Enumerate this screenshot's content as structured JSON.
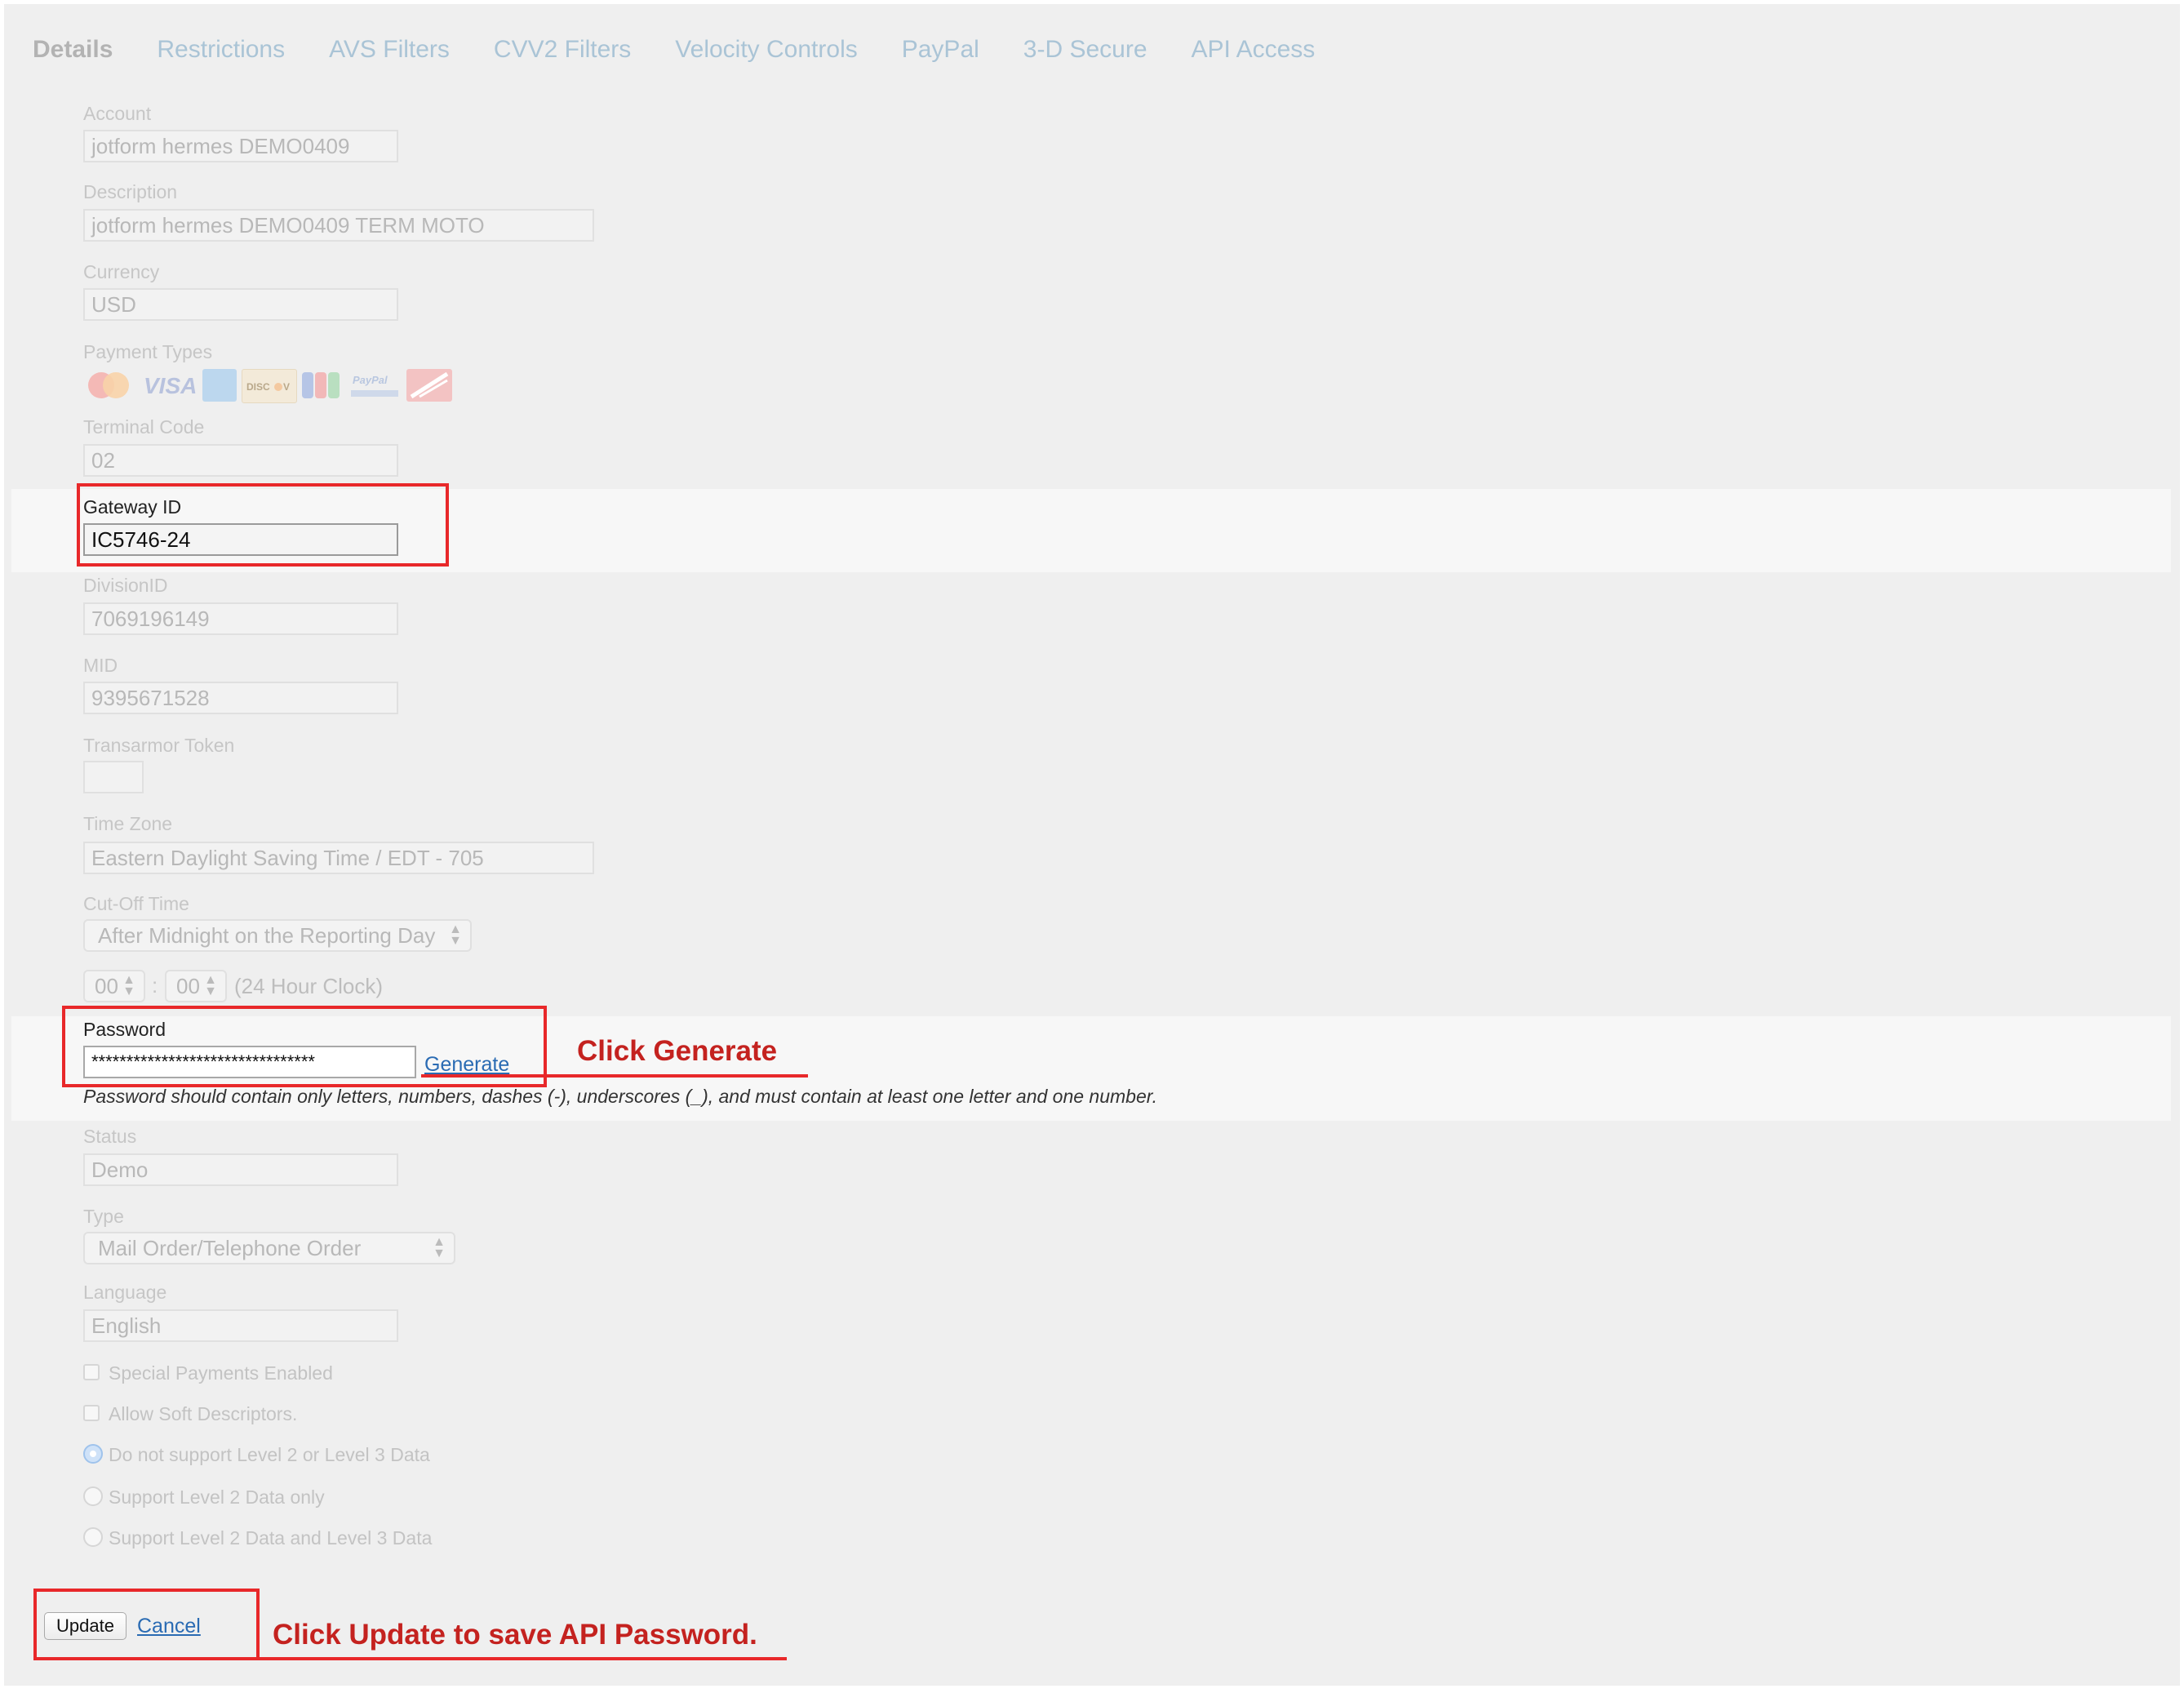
{
  "tabs": [
    {
      "label": "Details",
      "active": true
    },
    {
      "label": "Restrictions"
    },
    {
      "label": "AVS Filters"
    },
    {
      "label": "CVV2 Filters"
    },
    {
      "label": "Velocity Controls"
    },
    {
      "label": "PayPal"
    },
    {
      "label": "3-D Secure"
    },
    {
      "label": "API Access"
    }
  ],
  "fields": {
    "account": {
      "label": "Account",
      "value": "jotform hermes DEMO0409"
    },
    "description": {
      "label": "Description",
      "value": "jotform hermes DEMO0409 TERM MOTO"
    },
    "currency": {
      "label": "Currency",
      "value": "USD"
    },
    "payment_types": {
      "label": "Payment Types",
      "cards": [
        "mastercard-icon",
        "visa-icon",
        "amex-icon",
        "discover-icon",
        "jcb-icon",
        "paypal-icon",
        "telecheck-icon"
      ]
    },
    "terminal_code": {
      "label": "Terminal Code",
      "value": "02"
    },
    "gateway_id": {
      "label": "Gateway ID",
      "value": "IC5746-24"
    },
    "division_id": {
      "label": "DivisionID",
      "value": "7069196149"
    },
    "mid": {
      "label": "MID",
      "value": "9395671528"
    },
    "transarmor": {
      "label": "Transarmor Token",
      "value": ""
    },
    "time_zone": {
      "label": "Time Zone",
      "value": "Eastern Daylight Saving Time / EDT - 705"
    },
    "cutoff": {
      "label": "Cut-Off Time",
      "selected": "After Midnight on the Reporting Day",
      "hour": "00",
      "minute": "00",
      "separator": ":",
      "clock_note": "(24 Hour Clock)"
    },
    "password": {
      "label": "Password",
      "value": "********************************",
      "generate": "Generate",
      "hint": "Password should contain only letters, numbers, dashes (-), underscores (_), and must contain at least one letter and one number."
    },
    "status": {
      "label": "Status",
      "value": "Demo"
    },
    "type": {
      "label": "Type",
      "selected": "Mail Order/Telephone Order"
    },
    "language": {
      "label": "Language",
      "value": "English"
    }
  },
  "options": {
    "special_payments": {
      "label": "Special Payments Enabled",
      "checked": false
    },
    "soft_descriptors": {
      "label": "Allow Soft Descriptors.",
      "checked": false
    },
    "level_none": {
      "label": "Do not support Level 2 or Level 3 Data",
      "selected": true
    },
    "level_2": {
      "label": "Support Level 2 Data only",
      "selected": false
    },
    "level_2_3": {
      "label": "Support Level 2 Data and Level 3 Data",
      "selected": false
    }
  },
  "actions": {
    "update": "Update",
    "cancel": "Cancel"
  },
  "annotations": {
    "generate": "Click Generate",
    "update": "Click Update to save API Password."
  },
  "colors": {
    "annotation_red": "#e8282a",
    "link_blue": "#2a6bb3",
    "tab_inactive": "#aac4d6"
  }
}
